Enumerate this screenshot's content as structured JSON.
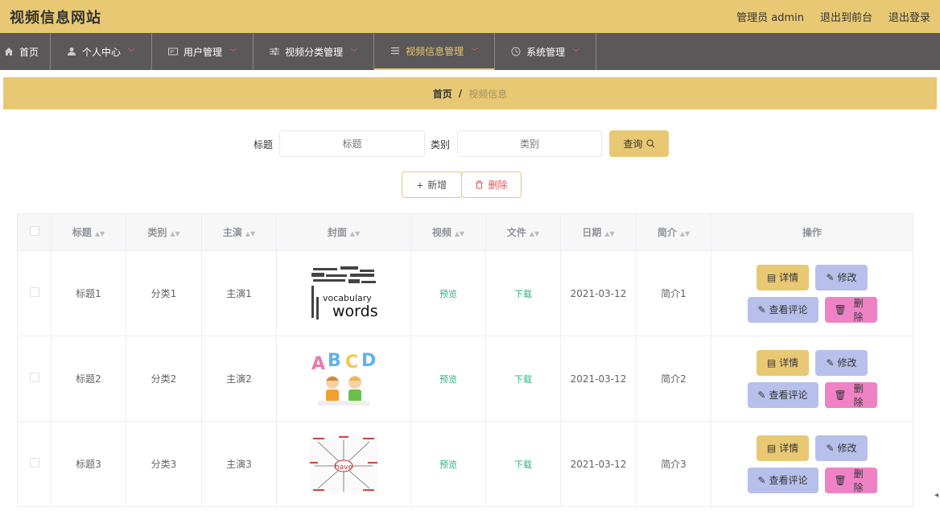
{
  "site_title": "视频信息网站",
  "top": {
    "user": "管理员 admin",
    "front": "退出到前台",
    "logout": "退出登录"
  },
  "nav": [
    {
      "label": "首页",
      "icon": "home-icon",
      "dropdown": false
    },
    {
      "label": "个人中心",
      "icon": "user-icon",
      "dropdown": true
    },
    {
      "label": "用户管理",
      "icon": "id-card-icon",
      "dropdown": true
    },
    {
      "label": "视频分类管理",
      "icon": "sliders-icon",
      "dropdown": true
    },
    {
      "label": "视频信息管理",
      "icon": "list-icon",
      "dropdown": true,
      "active": true
    },
    {
      "label": "系统管理",
      "icon": "clock-icon",
      "dropdown": true
    }
  ],
  "breadcrumb": {
    "home": "首页",
    "sep": "/",
    "current": "视频信息"
  },
  "search": {
    "title_label": "标题",
    "title_placeholder": "标题",
    "category_label": "类别",
    "category_placeholder": "类别",
    "query_button": "查询"
  },
  "actions": {
    "add": "新增",
    "delete": "删除"
  },
  "table": {
    "headers": [
      "标题",
      "类别",
      "主演",
      "封面",
      "视频",
      "文件",
      "日期",
      "简介",
      "操作"
    ],
    "rows": [
      {
        "title": "标题1",
        "category": "分类1",
        "actor": "主演1",
        "cover": "word-cloud",
        "video": "预览",
        "file": "下载",
        "date": "2021-03-12",
        "intro": "简介1"
      },
      {
        "title": "标题2",
        "category": "分类2",
        "actor": "主演2",
        "cover": "abcd-kids",
        "video": "预览",
        "file": "下载",
        "date": "2021-03-12",
        "intro": "简介2"
      },
      {
        "title": "标题3",
        "category": "分类3",
        "actor": "主演3",
        "cover": "have-mindmap",
        "video": "预览",
        "file": "下载",
        "date": "2021-03-12",
        "intro": "简介3"
      }
    ],
    "ops": {
      "detail": "详情",
      "edit": "修改",
      "comment": "查看评论",
      "remove": "删除"
    }
  },
  "colors": {
    "accent": "#e8c872",
    "nav_bg": "#5a5858",
    "link": "#2db37c",
    "edit_btn": "#b6c0ea",
    "remove_btn": "#ee82c4",
    "danger": "#e05555"
  },
  "cover_text": {
    "word-cloud": "vocabulary words",
    "abcd-kids": "ABCD",
    "have-mindmap": "have"
  }
}
